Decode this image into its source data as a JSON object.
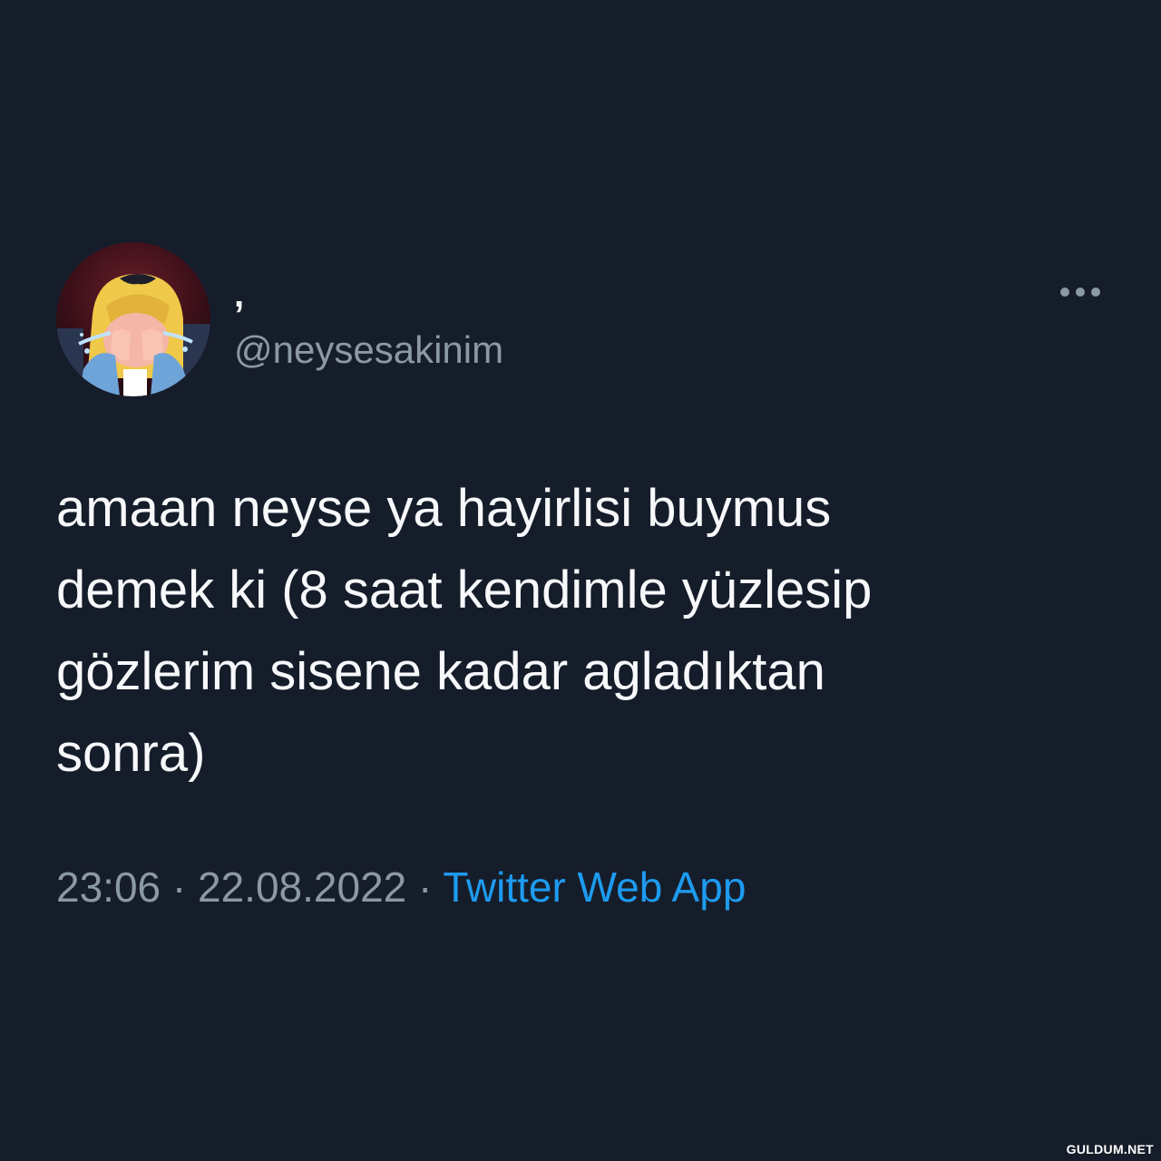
{
  "tweet": {
    "display_name": ",",
    "handle": "@neysesakinim",
    "text": "amaan neyse ya hayirlisi buymus\ndemek ki (8 saat kendimle yüzlesip\ngözlerim sisene kadar agladıktan\nsonra)",
    "time": "23:06",
    "separator": "·",
    "date": "22.08.2022",
    "source": "Twitter Web App"
  },
  "icons": {
    "more": "more-horizontal-icon",
    "avatar": "crying-cartoon-girl-avatar"
  },
  "watermark": "GULDUM.NET",
  "colors": {
    "background": "#161d2a",
    "text_primary": "#f6f8fa",
    "text_secondary": "#8b98a5",
    "link": "#1d9bf0"
  }
}
